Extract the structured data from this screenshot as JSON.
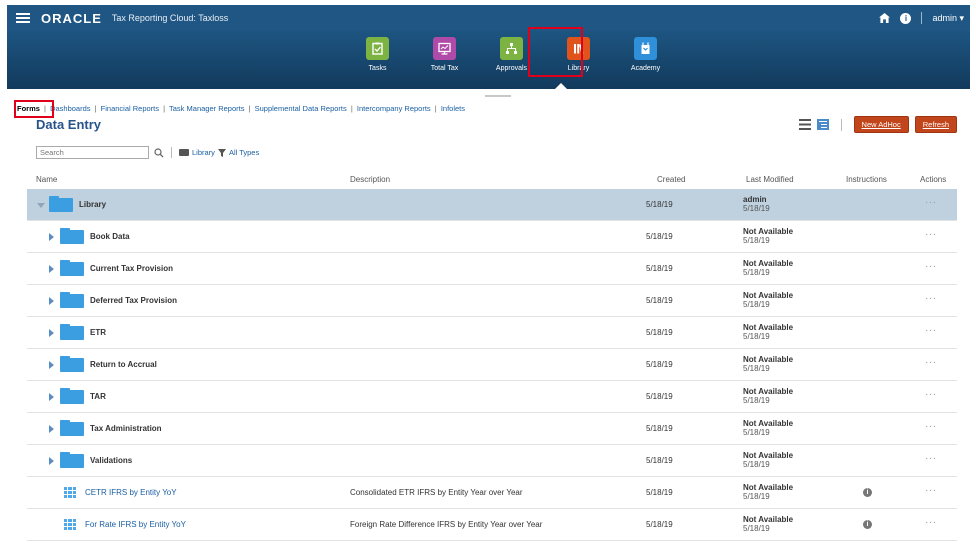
{
  "topbar": {
    "brand": "ORACLE",
    "app_title": "Tax Reporting Cloud: Taxloss",
    "user": "admin ▾",
    "help_glyph": "i"
  },
  "navigator": {
    "cards": [
      {
        "label": "Tasks",
        "color": "#7cb342",
        "icon": "clipboard-icon"
      },
      {
        "label": "Total Tax",
        "color": "#b04aa8",
        "icon": "monitor-icon"
      },
      {
        "label": "Approvals",
        "color": "#7cb342",
        "icon": "hierarchy-icon"
      },
      {
        "label": "Library",
        "color": "#e0541c",
        "icon": "books-icon"
      },
      {
        "label": "Academy",
        "color": "#2f8fd8",
        "icon": "academy-icon"
      }
    ],
    "selected": "Library"
  },
  "tabs": {
    "items": [
      "Forms",
      "Dashboards",
      "Financial Reports",
      "Task Manager Reports",
      "Supplemental Data Reports",
      "Intercompany Reports",
      "Infolets"
    ],
    "separator": "|"
  },
  "page": {
    "title": "Data Entry",
    "new_adhoc": "New AdHoc",
    "refresh": "Refresh"
  },
  "search": {
    "placeholder": "Search",
    "library_filter": "Library",
    "all_types": "All Types"
  },
  "table": {
    "columns": {
      "name": "Name",
      "description": "Description",
      "created": "Created",
      "last_modified": "Last Modified",
      "instructions": "Instructions",
      "actions": "Actions"
    },
    "rows": [
      {
        "name": "Library",
        "type": "folder",
        "expanded": true,
        "description": "",
        "created": "5/18/19",
        "modified_by": "admin",
        "modified_on": "5/18/19",
        "info": false
      },
      {
        "name": "Book Data",
        "type": "folder",
        "description": "",
        "created": "5/18/19",
        "modified_by": "Not Available",
        "modified_on": "5/18/19",
        "info": false
      },
      {
        "name": "Current Tax Provision",
        "type": "folder",
        "description": "",
        "created": "5/18/19",
        "modified_by": "Not Available",
        "modified_on": "5/18/19",
        "info": false
      },
      {
        "name": "Deferred Tax Provision",
        "type": "folder",
        "description": "",
        "created": "5/18/19",
        "modified_by": "Not Available",
        "modified_on": "5/18/19",
        "info": false
      },
      {
        "name": "ETR",
        "type": "folder",
        "description": "",
        "created": "5/18/19",
        "modified_by": "Not Available",
        "modified_on": "5/18/19",
        "info": false
      },
      {
        "name": "Return to Accrual",
        "type": "folder",
        "description": "",
        "created": "5/18/19",
        "modified_by": "Not Available",
        "modified_on": "5/18/19",
        "info": false
      },
      {
        "name": "TAR",
        "type": "folder",
        "description": "",
        "created": "5/18/19",
        "modified_by": "Not Available",
        "modified_on": "5/18/19",
        "info": false
      },
      {
        "name": "Tax Administration",
        "type": "folder",
        "description": "",
        "created": "5/18/19",
        "modified_by": "Not Available",
        "modified_on": "5/18/19",
        "info": false
      },
      {
        "name": "Validations",
        "type": "folder",
        "description": "",
        "created": "5/18/19",
        "modified_by": "Not Available",
        "modified_on": "5/18/19",
        "info": false
      },
      {
        "name": "CETR IFRS by Entity YoY",
        "type": "form",
        "description": "Consolidated ETR IFRS by Entity Year over Year",
        "created": "5/18/19",
        "modified_by": "Not Available",
        "modified_on": "5/18/19",
        "info": true
      },
      {
        "name": "For Rate IFRS by Entity YoY",
        "type": "form",
        "description": "Foreign Rate Difference IFRS by Entity Year over Year",
        "created": "5/18/19",
        "modified_by": "Not Available",
        "modified_on": "5/18/19",
        "info": true
      }
    ],
    "actions_glyph": "···",
    "info_glyph": "i"
  },
  "colors": {
    "topbar": "#1f5683",
    "accent_button": "#c2461b",
    "selected_row": "#bfd0de",
    "folder": "#3a9ee0",
    "link": "#1a5fa3",
    "highlight_box": "#e0001b"
  }
}
